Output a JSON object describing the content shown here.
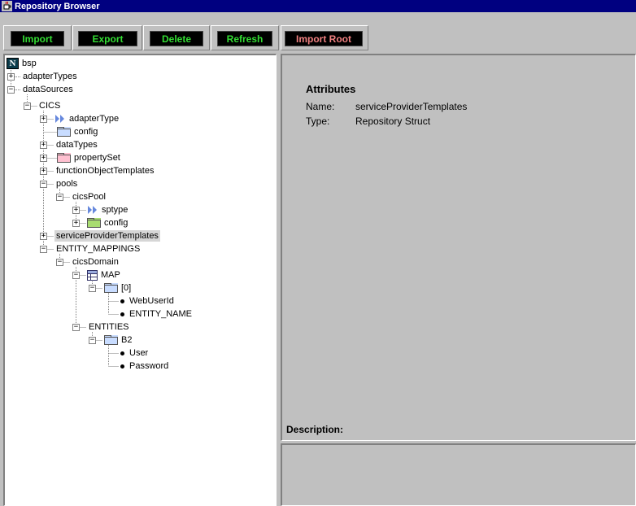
{
  "window": {
    "title": "Repository Browser"
  },
  "toolbar": {
    "import": "Import",
    "export": "Export",
    "delete": "Delete",
    "refresh": "Refresh",
    "import_root": "Import Root"
  },
  "tree": {
    "bsp": "bsp",
    "adapterTypes": "adapterTypes",
    "dataSources": "dataSources",
    "cics": "CICS",
    "adapterType": "adapterType",
    "config": "config",
    "dataTypes": "dataTypes",
    "propertySet": "propertySet",
    "functionObjectTemplates": "functionObjectTemplates",
    "pools": "pools",
    "cicsPool": "cicsPool",
    "sptype": "sptype",
    "pool_config": "config",
    "serviceProviderTemplates": "serviceProviderTemplates",
    "entityMappings": "ENTITY_MAPPINGS",
    "cicsDomain": "cicsDomain",
    "map": "MAP",
    "index0": "[0]",
    "webUserId": "WebUserId",
    "entityName": "ENTITY_NAME",
    "entities": "ENTITIES",
    "b2": "B2",
    "user": "User",
    "password": "Password"
  },
  "attributes": {
    "heading": "Attributes",
    "name_label": "Name:",
    "name_value": "serviceProviderTemplates",
    "type_label": "Type:",
    "type_value": "Repository Struct",
    "description_label": "Description:"
  },
  "colors": {
    "titlebar": "#000080",
    "button_text": "#33dd33",
    "import_root_text": "#f08080",
    "folder_blue": "#c8dcff",
    "folder_pink": "#ffc0d0",
    "folder_green": "#a8dc70",
    "arrow_blue": "#6688dd"
  },
  "icons": {
    "title": "coffee-cup-icon",
    "root": "n-logo-icon",
    "expander": "plus-minus-box",
    "folder": "folder-icon",
    "type": "double-arrow-icon",
    "table": "grid-icon",
    "leaf": "bullet-icon"
  }
}
